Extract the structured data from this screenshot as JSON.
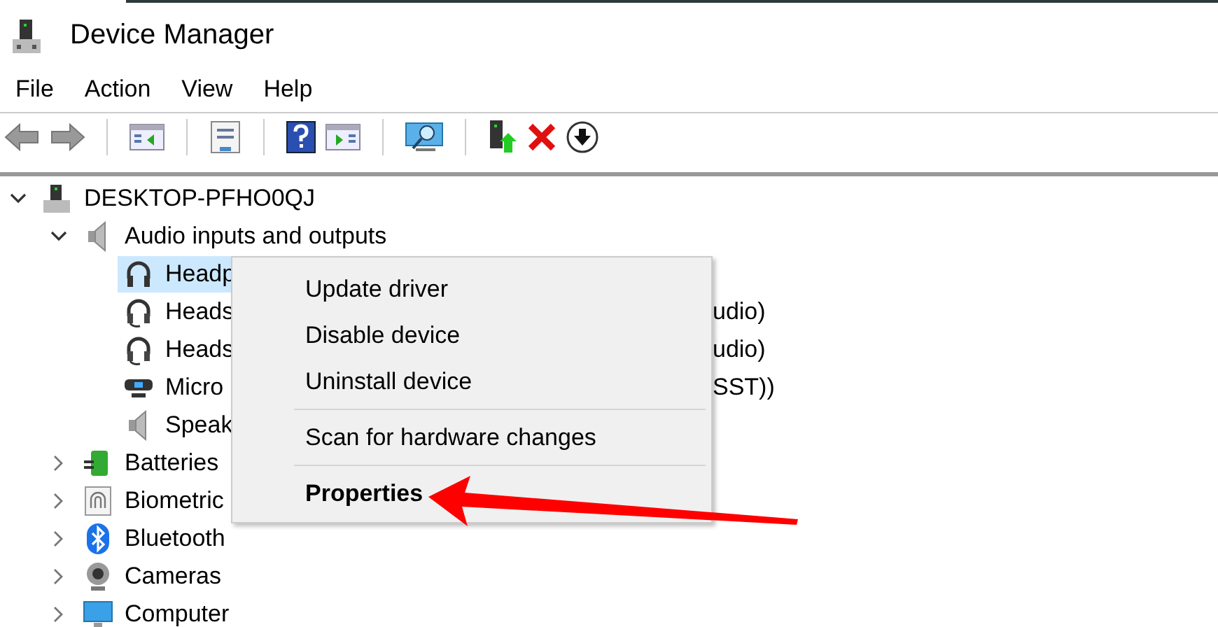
{
  "window": {
    "title": "Device Manager"
  },
  "menu_bar": [
    "File",
    "Action",
    "View",
    "Help"
  ],
  "tree": [
    {
      "label": "DESKTOP-PFHO0QJ",
      "kind": "computer",
      "expanded": true,
      "selected": false,
      "children": [
        {
          "label": "Audio inputs and outputs",
          "kind": "speaker",
          "expanded": true,
          "selected": false,
          "children": [
            {
              "label": "Headp",
              "kind": "headphones",
              "selected": true
            },
            {
              "label": "Heads",
              "tail": "udio)",
              "kind": "headset",
              "selected": false
            },
            {
              "label": "Heads",
              "tail": "udio)",
              "kind": "headset",
              "selected": false
            },
            {
              "label": "Micro",
              "tail": "SST))",
              "kind": "webcam",
              "selected": false
            },
            {
              "label": "Speak",
              "kind": "speaker",
              "selected": false
            }
          ]
        },
        {
          "label": "Batteries",
          "kind": "battery",
          "expanded": false,
          "selected": false
        },
        {
          "label": "Biometric",
          "kind": "fingerprint",
          "expanded": false,
          "selected": false
        },
        {
          "label": "Bluetooth",
          "kind": "bluetooth",
          "expanded": false,
          "selected": false
        },
        {
          "label": "Cameras",
          "kind": "camera",
          "expanded": false,
          "selected": false
        },
        {
          "label": "Computer",
          "kind": "monitor",
          "expanded": false,
          "selected": false
        }
      ]
    }
  ],
  "context_menu": [
    {
      "kind": "item",
      "label": "Update driver",
      "default": false
    },
    {
      "kind": "item",
      "label": "Disable device",
      "default": false
    },
    {
      "kind": "item",
      "label": "Uninstall device",
      "default": false
    },
    {
      "kind": "separator"
    },
    {
      "kind": "item",
      "label": "Scan for hardware changes",
      "default": false
    },
    {
      "kind": "separator"
    },
    {
      "kind": "item",
      "label": "Properties",
      "default": true
    }
  ]
}
